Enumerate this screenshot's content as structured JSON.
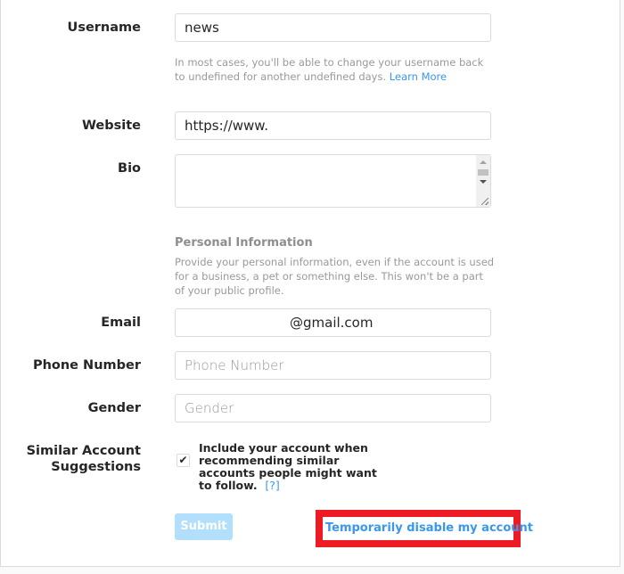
{
  "form": {
    "username": {
      "label": "Username",
      "value": "news"
    },
    "username_help": {
      "text": "In most cases, you'll be able to change your username back to undefined for another undefined days.",
      "link": "Learn More"
    },
    "website": {
      "label": "Website",
      "value": "https://www."
    },
    "bio": {
      "label": "Bio",
      "value": ""
    },
    "personal_info": {
      "heading": "Personal Information",
      "text": "Provide your personal information, even if the account is used for a business, a pet or something else. This won't be a part of your public profile."
    },
    "email": {
      "label": "Email",
      "value": "@gmail.com"
    },
    "phone": {
      "label": "Phone Number",
      "placeholder": "Phone Number"
    },
    "gender": {
      "label": "Gender",
      "placeholder": "Gender"
    },
    "similar": {
      "label_line1": "Similar Account",
      "label_line2": "Suggestions",
      "checkbox_text": "Include your account when recommending similar accounts people might want to follow.",
      "help_link": "[?]",
      "checked": true
    },
    "submit_label": "Submit",
    "disable_link": "Temporarily disable my account"
  },
  "colors": {
    "link": "#3897f0",
    "submit_disabled": "#b2dffc",
    "highlight_box": "#ed1c24"
  }
}
